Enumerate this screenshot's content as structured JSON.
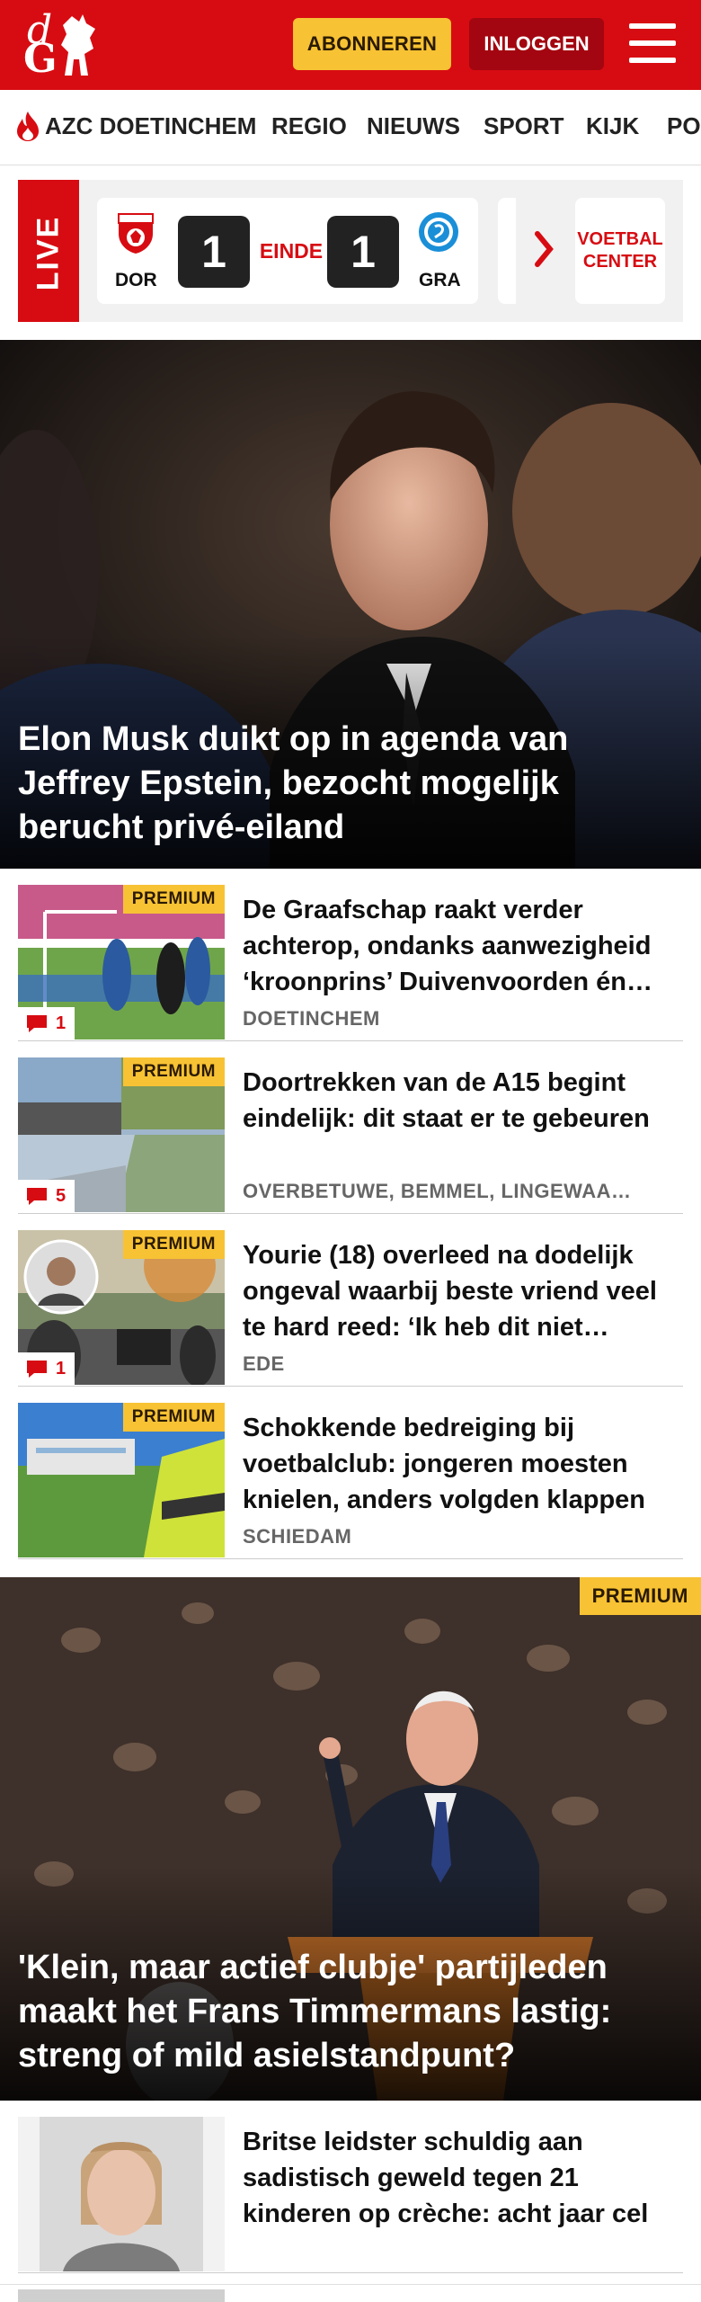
{
  "header": {
    "logo_text_d": "d",
    "logo_text_g": "G",
    "subscribe_label": "ABONNEREN",
    "login_label": "INLOGGEN",
    "colors": {
      "brand_red": "#d70c12",
      "premium_yellow": "#f7c234"
    }
  },
  "nav": {
    "items": [
      "AZC DOETINCHEM",
      "REGIO",
      "NIEUWS",
      "SPORT",
      "KIJK",
      "PO"
    ]
  },
  "live": {
    "tag": "LIVE",
    "match": {
      "home_code": "DOR",
      "away_code": "GRA",
      "home_score": "1",
      "away_score": "1",
      "status": "EINDE"
    },
    "football_center_label": "VOETBAL CENTER"
  },
  "hero": {
    "title": "Elon Musk duikt op in agenda van Jeffrey Epstein, bezocht mogelijk berucht privé-eiland"
  },
  "articles": [
    {
      "premium": "PREMIUM",
      "comments": "1",
      "title": "De Graafschap raakt verder achterop, ondanks aanwezigheid ‘kroonprins’ Duivenvoorden én…",
      "location": "DOETINCHEM"
    },
    {
      "premium": "PREMIUM",
      "comments": "5",
      "title": "Doortrekken van de A15 begint eindelijk: dit staat er te gebeuren",
      "location": "OVERBETUWE, BEMMEL, LINGEWAA…"
    },
    {
      "premium": "PREMIUM",
      "comments": "1",
      "title": "Yourie (18) overleed na dodelijk ongeval waarbij beste vriend veel te hard reed: ‘Ik heb dit niet…",
      "location": "EDE"
    },
    {
      "premium": "PREMIUM",
      "title": "Schokkende bedreiging bij voetbalclub: jongeren moesten knielen, anders volgden klappen",
      "location": "SCHIEDAM"
    }
  ],
  "big_story": {
    "premium": "PREMIUM",
    "title": "'Klein, maar actief clubje' partijleden maakt het Frans Timmermans lastig: streng of mild asielstandpunt?"
  },
  "bottom_article": {
    "title": "Britse leidster schuldig aan sadistisch geweld tegen 21 kinderen op crèche: acht jaar cel"
  }
}
